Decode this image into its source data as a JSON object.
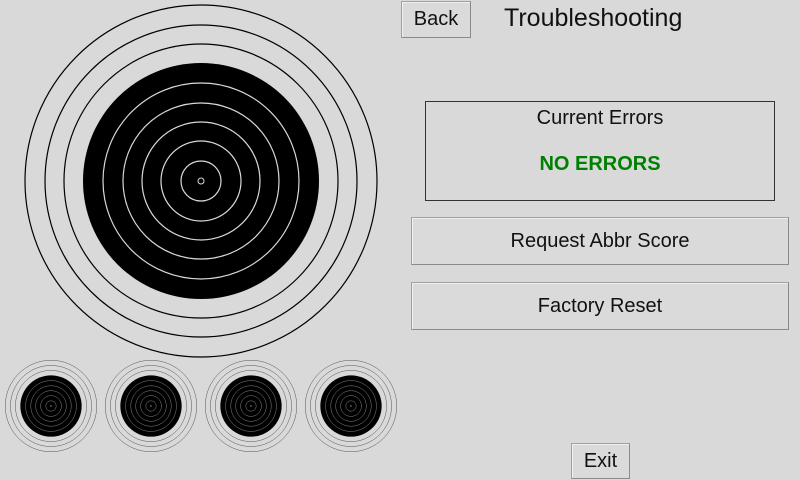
{
  "header": {
    "back_label": "Back",
    "title": "Troubleshooting"
  },
  "errors": {
    "title": "Current Errors",
    "status": "NO ERRORS",
    "status_color": "#008000"
  },
  "actions": {
    "request_label": "Request Abbr Score",
    "reset_label": "Factory Reset",
    "exit_label": "Exit"
  },
  "targets": {
    "main_count": 1,
    "mini_count": 4,
    "ring_color": "#000000",
    "background": "#d9d9d9"
  }
}
